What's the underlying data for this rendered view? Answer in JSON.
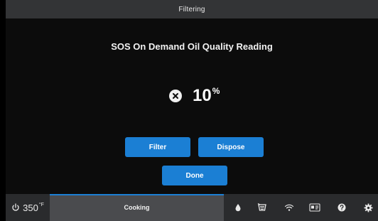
{
  "header": {
    "title": "Filtering"
  },
  "main": {
    "heading": "SOS On Demand Oil Quality Reading",
    "reading": {
      "status_icon": "x-circle-icon",
      "value": "10",
      "unit": "%"
    },
    "buttons": {
      "filter_label": "Filter",
      "dispose_label": "Dispose",
      "done_label": "Done"
    }
  },
  "bottom_bar": {
    "power_icon": "power-icon",
    "temperature": "350",
    "temperature_unit": "°F",
    "active_tab_label": "Cooking",
    "active_tab_progress": 1.0,
    "icons": [
      "oil-drop-icon",
      "fryer-basket-icon",
      "wifi-icon",
      "id-card-icon",
      "help-icon",
      "settings-gear-icon"
    ]
  },
  "colors": {
    "background": "#0c0c0c",
    "title_bar": "#333436",
    "accent": "#1b7fd4",
    "bottom_bar": "#2a2b2d",
    "active_tab": "#4a4b4e"
  }
}
